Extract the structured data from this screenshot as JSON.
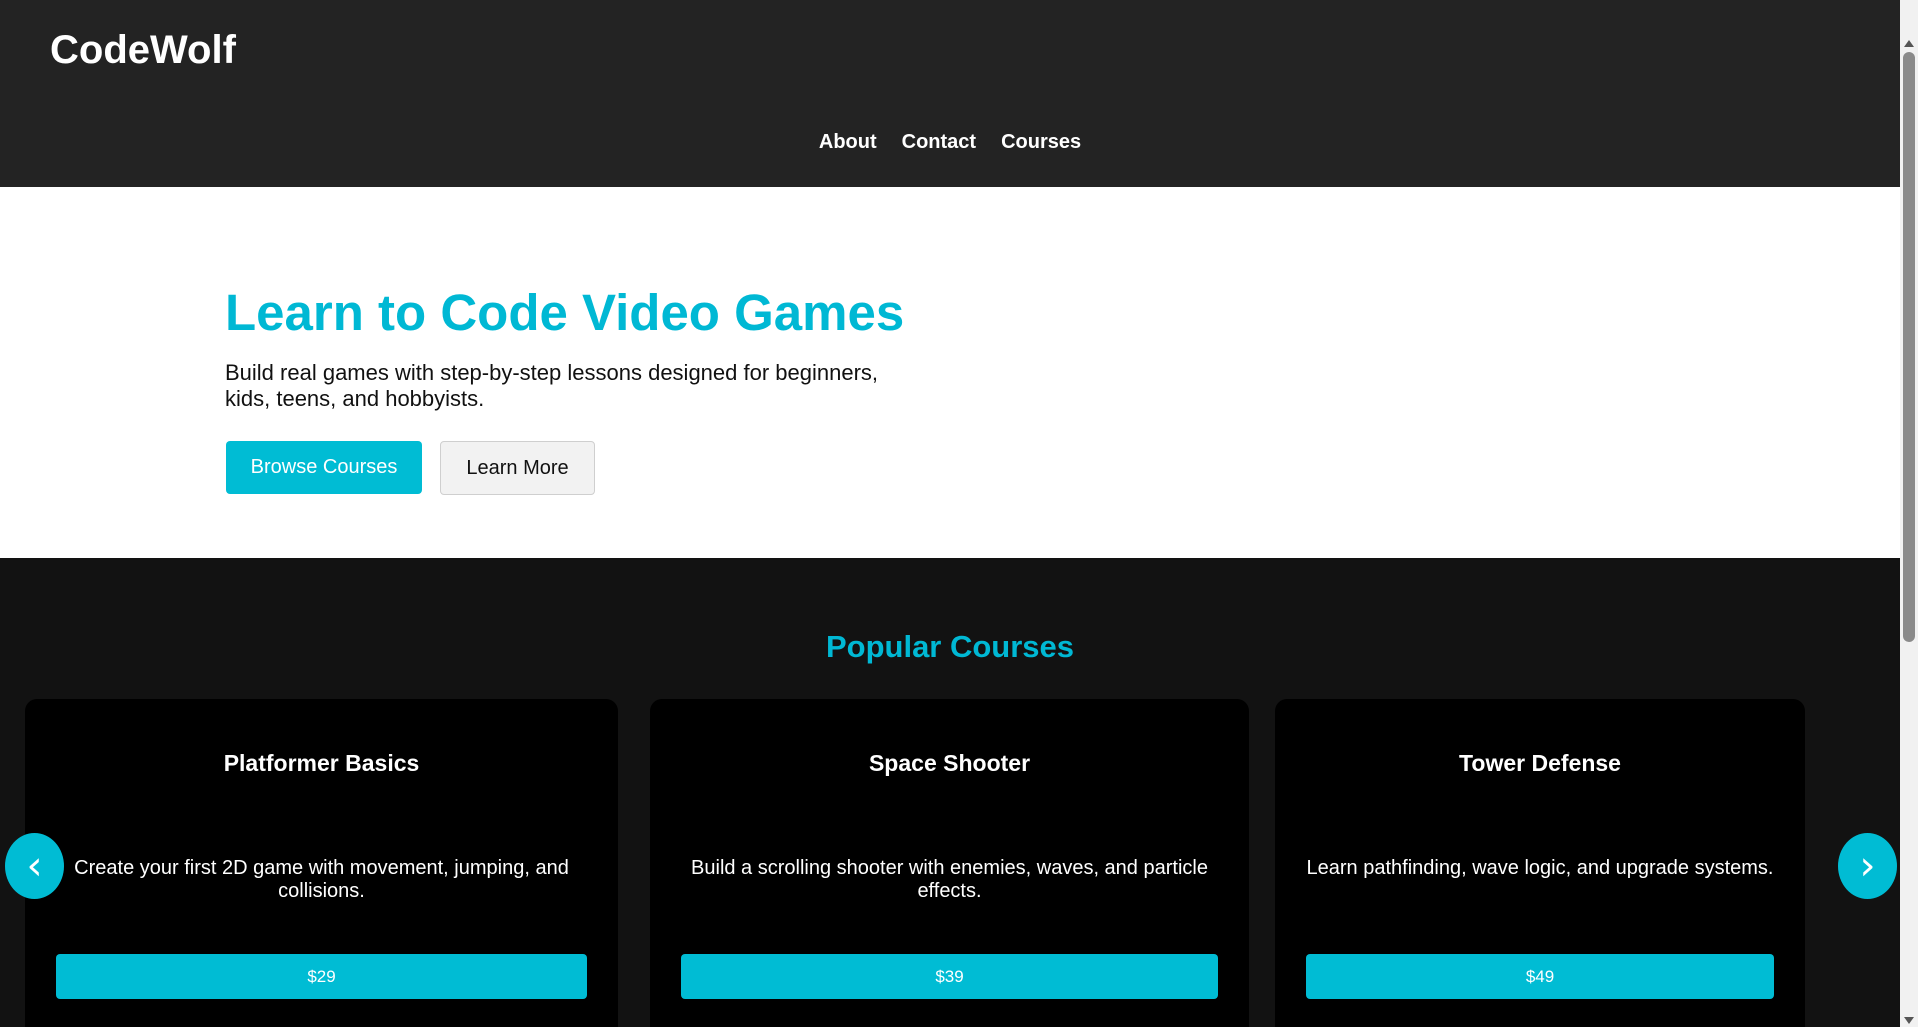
{
  "header": {
    "logo": "CodeWolf",
    "nav": [
      "About",
      "Contact",
      "Courses"
    ]
  },
  "hero": {
    "title": "Learn to Code Video Games",
    "subtitle": "Build real games with step-by-step lessons designed for beginners, kids, teens, and hobbyists.",
    "primary_button": "Browse Courses",
    "secondary_button": "Learn More"
  },
  "courses": {
    "heading": "Popular Courses",
    "prev_icon": "‹",
    "next_icon": "›",
    "items": [
      {
        "title": "Platformer Basics",
        "description": "Create your first 2D game with movement, jumping, and collisions.",
        "price": "$29"
      },
      {
        "title": "Space Shooter",
        "description": "Build a scrolling shooter with enemies, waves, and particle effects.",
        "price": "$39"
      },
      {
        "title": "Tower Defense",
        "description": "Learn pathfinding, wave logic, and upgrade systems.",
        "price": "$49"
      }
    ]
  },
  "colors": {
    "accent": "#00BCD4",
    "header_bg": "#232323",
    "section_bg": "#121212",
    "card_bg": "#000000"
  }
}
